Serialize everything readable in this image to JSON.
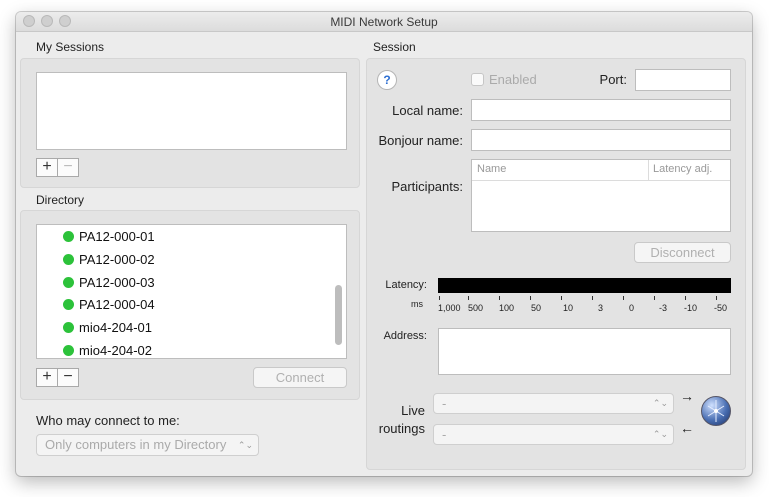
{
  "window": {
    "title": "MIDI Network Setup"
  },
  "my_sessions": {
    "heading": "My Sessions",
    "add_symbol": "+",
    "remove_symbol": "−"
  },
  "directory": {
    "heading": "Directory",
    "items": [
      "PA12-000-01",
      "PA12-000-02",
      "PA12-000-03",
      "PA12-000-04",
      "mio4-204-01",
      "mio4-204-02"
    ],
    "status_color": "#2cc23a",
    "add_symbol": "+",
    "remove_symbol": "−",
    "connect_label": "Connect"
  },
  "who_may_connect": {
    "label": "Who may connect to me:",
    "selected": "Only computers in my Directory"
  },
  "session": {
    "heading": "Session",
    "help_symbol": "?",
    "enabled_label": "Enabled",
    "port_label": "Port:",
    "local_name_label": "Local name:",
    "bonjour_name_label": "Bonjour name:",
    "participants_label": "Participants:",
    "participants_columns": [
      "Name",
      "Latency adj."
    ],
    "disconnect_label": "Disconnect",
    "latency_label": "Latency:",
    "latency_unit": "ms",
    "latency_ticks": [
      "1,000",
      "500",
      "100",
      "50",
      "10",
      "3",
      "0",
      "-3",
      "-10",
      "-50"
    ],
    "address_label": "Address:",
    "live_routings_label_1": "Live",
    "live_routings_label_2": "routings",
    "routing_in_value": "-",
    "routing_out_value": "-",
    "arrow_right": "→",
    "arrow_left": "←"
  }
}
